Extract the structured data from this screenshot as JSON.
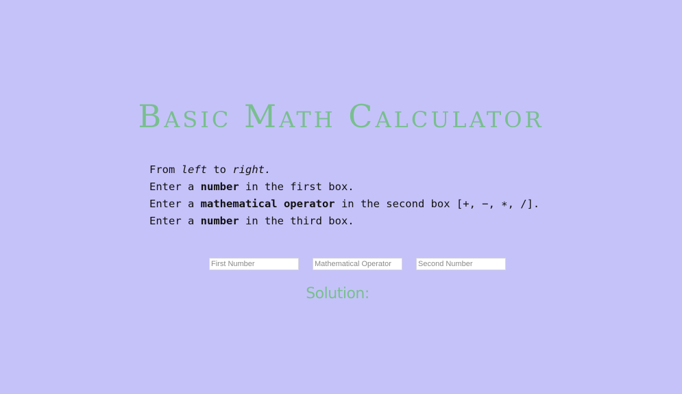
{
  "header": {
    "title": "Basic Math Calculator"
  },
  "instructions": {
    "line1": {
      "a": "From ",
      "b": "left",
      "c": " to ",
      "d": "right."
    },
    "line2": {
      "a": "Enter a ",
      "b": "number",
      "c": " in the first box."
    },
    "line3": {
      "a": "Enter a ",
      "b": "mathematical operator",
      "c": " in the second box [+, −, ∗, /]."
    },
    "line4": {
      "a": "Enter a ",
      "b": "number",
      "c": " in the third box."
    }
  },
  "inputs": {
    "first": {
      "placeholder": "First Number",
      "value": ""
    },
    "operator": {
      "placeholder": "Mathematical Operator",
      "value": ""
    },
    "second": {
      "placeholder": "Second Number",
      "value": ""
    }
  },
  "result": {
    "label": "Solution:"
  },
  "colors": {
    "background": "#c5c2f9",
    "accent": "#78bf8e",
    "text": "#111111"
  }
}
